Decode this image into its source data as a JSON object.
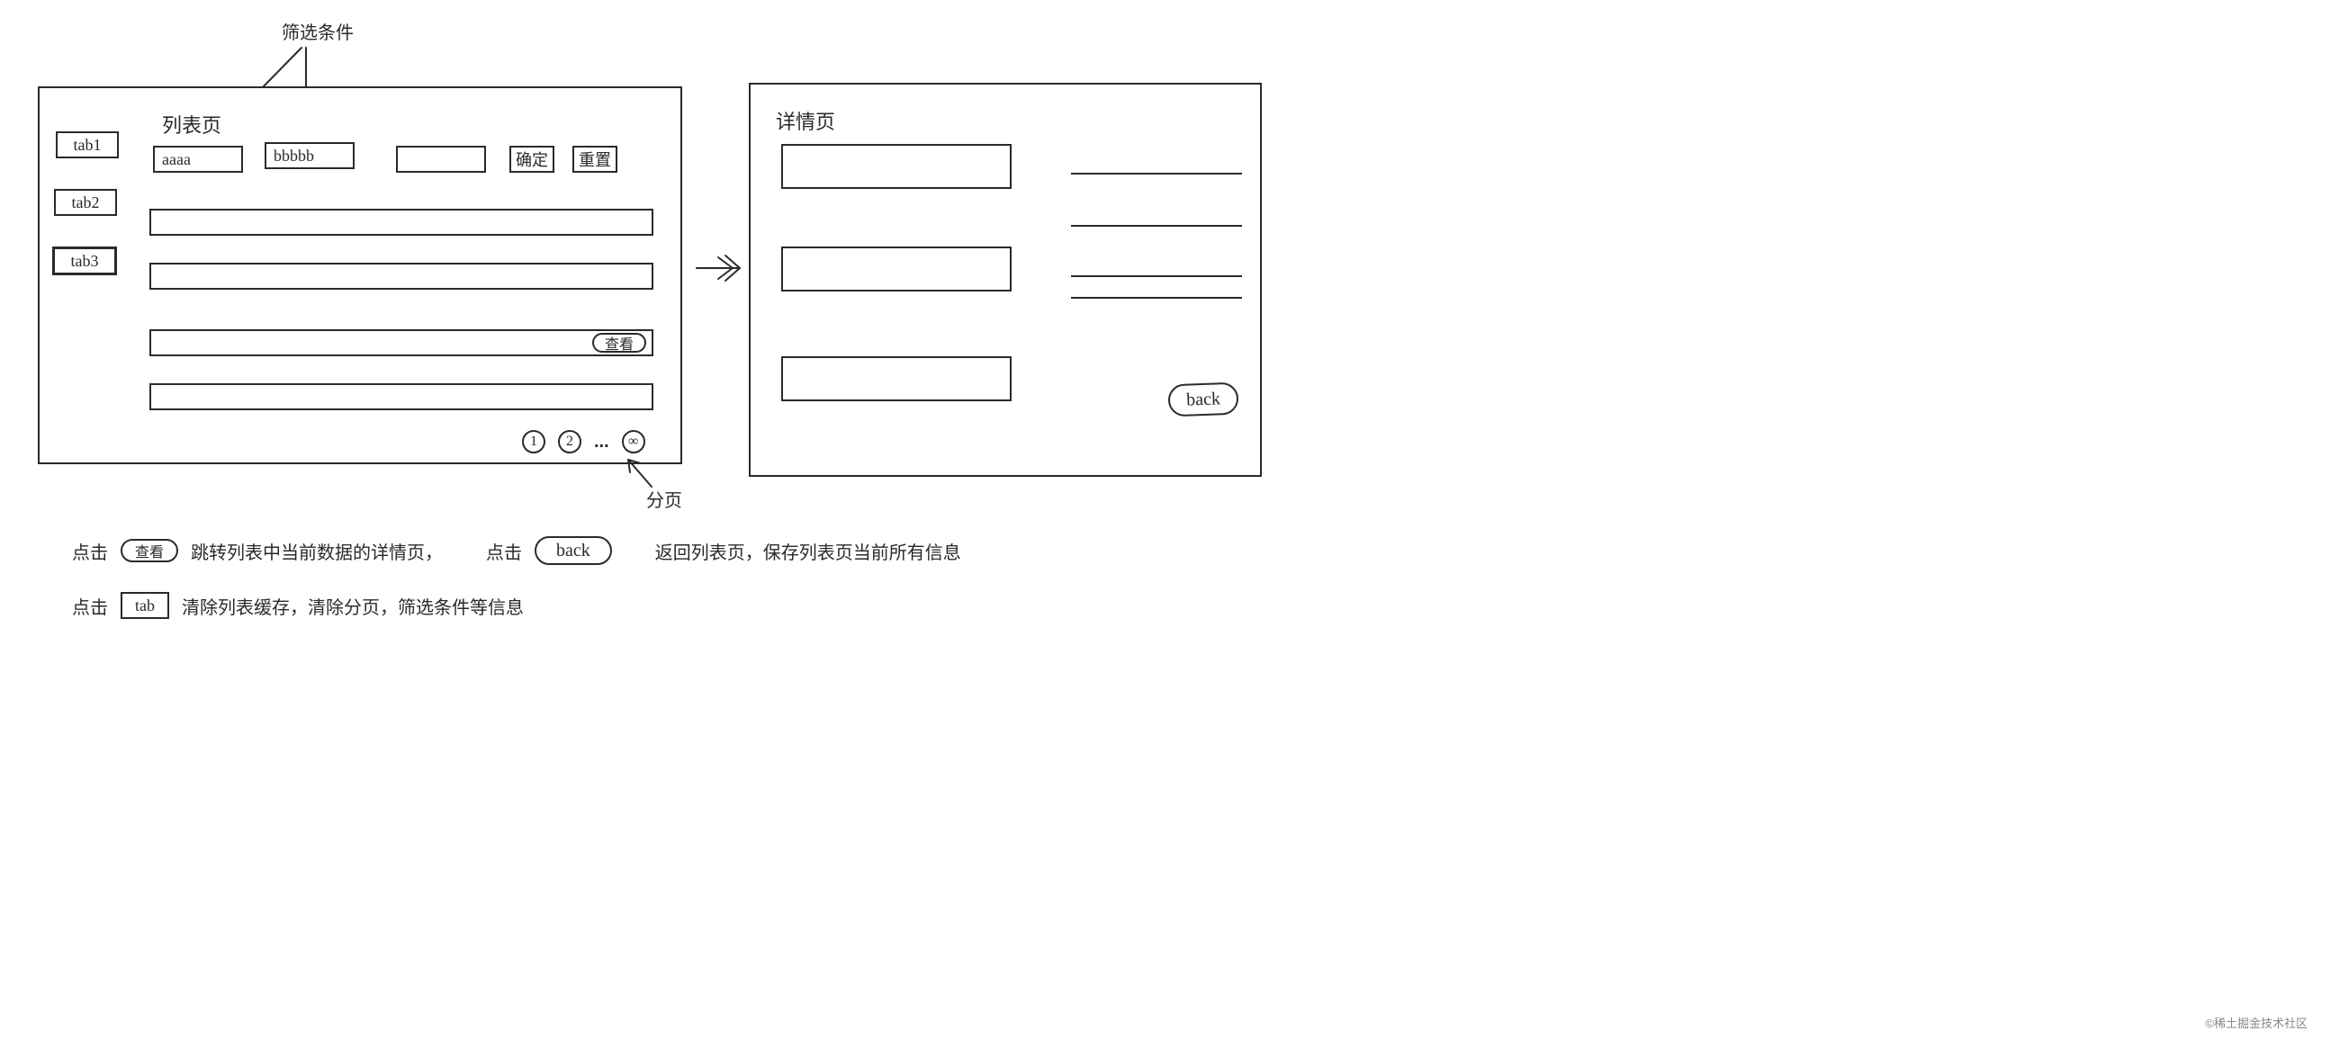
{
  "annotations": {
    "filter_label": "筛选条件",
    "pagination_label": "分页"
  },
  "list_page": {
    "title": "列表页",
    "tabs": [
      "tab1",
      "tab2",
      "tab3"
    ],
    "filters": {
      "f1": "aaaa",
      "f2": "bbbbb",
      "f3": ""
    },
    "buttons": {
      "ok": "确定",
      "reset": "重置"
    },
    "row_action": "查看",
    "pager": {
      "p1": "1",
      "p2": "2",
      "dots": "...",
      "last": "∞"
    }
  },
  "detail_page": {
    "title": "详情页",
    "back": "back"
  },
  "footer": {
    "line1_a": "点击",
    "line1_view": "查看",
    "line1_b": "跳转列表中当前数据的详情页，",
    "line1_c": "点击",
    "line1_back": "back",
    "line1_d": "返回列表页，保存列表页当前所有信息",
    "line2_a": "点击",
    "line2_tab": "tab",
    "line2_b": "清除列表缓存，清除分页，筛选条件等信息"
  },
  "watermark": "©稀土掘金技术社区"
}
